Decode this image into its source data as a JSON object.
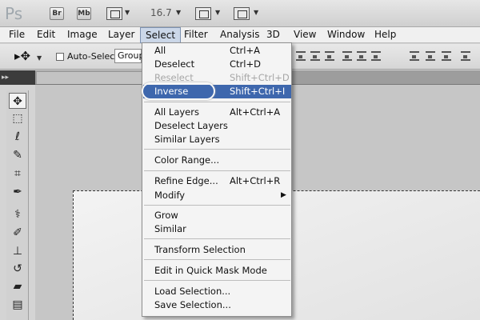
{
  "appbar": {
    "logo": "Ps",
    "bridge_label": "Br",
    "minibridge_label": "Mb",
    "zoom": "16.7",
    "caret": "▼"
  },
  "menubar": [
    "File",
    "Edit",
    "Image",
    "Layer",
    "Select",
    "Filter",
    "Analysis",
    "3D",
    "View",
    "Window",
    "Help"
  ],
  "menubar_active": "Select",
  "options": {
    "auto_select_label": "Auto-Select:",
    "auto_select_value": "Group"
  },
  "select_menu": {
    "all": {
      "label": "All",
      "shortcut": "Ctrl+A"
    },
    "deselect": {
      "label": "Deselect",
      "shortcut": "Ctrl+D"
    },
    "reselect": {
      "label": "Reselect",
      "shortcut": "Shift+Ctrl+D"
    },
    "inverse": {
      "label": "Inverse",
      "shortcut": "Shift+Ctrl+I"
    },
    "all_layers": {
      "label": "All Layers",
      "shortcut": "Alt+Ctrl+A"
    },
    "deselect_layers": {
      "label": "Deselect Layers"
    },
    "similar_layers": {
      "label": "Similar Layers"
    },
    "color_range": {
      "label": "Color Range..."
    },
    "refine_edge": {
      "label": "Refine Edge...",
      "shortcut": "Alt+Ctrl+R"
    },
    "modify": {
      "label": "Modify"
    },
    "grow": {
      "label": "Grow"
    },
    "similar": {
      "label": "Similar"
    },
    "transform_selection": {
      "label": "Transform Selection"
    },
    "quick_mask": {
      "label": "Edit in Quick Mask Mode"
    },
    "load_selection": {
      "label": "Load Selection..."
    },
    "save_selection": {
      "label": "Save Selection..."
    }
  },
  "tools_header": "▸▸",
  "tool_icons": [
    "move-icon",
    "marquee-icon",
    "lasso-icon",
    "quick-select-icon",
    "crop-icon",
    "eyedropper-icon",
    "healing-icon",
    "brush-icon",
    "stamp-icon",
    "history-brush-icon",
    "eraser-icon",
    "gradient-icon"
  ],
  "colors": {
    "highlight": "#3e67ad",
    "menu_bg": "#f4f4f4"
  }
}
